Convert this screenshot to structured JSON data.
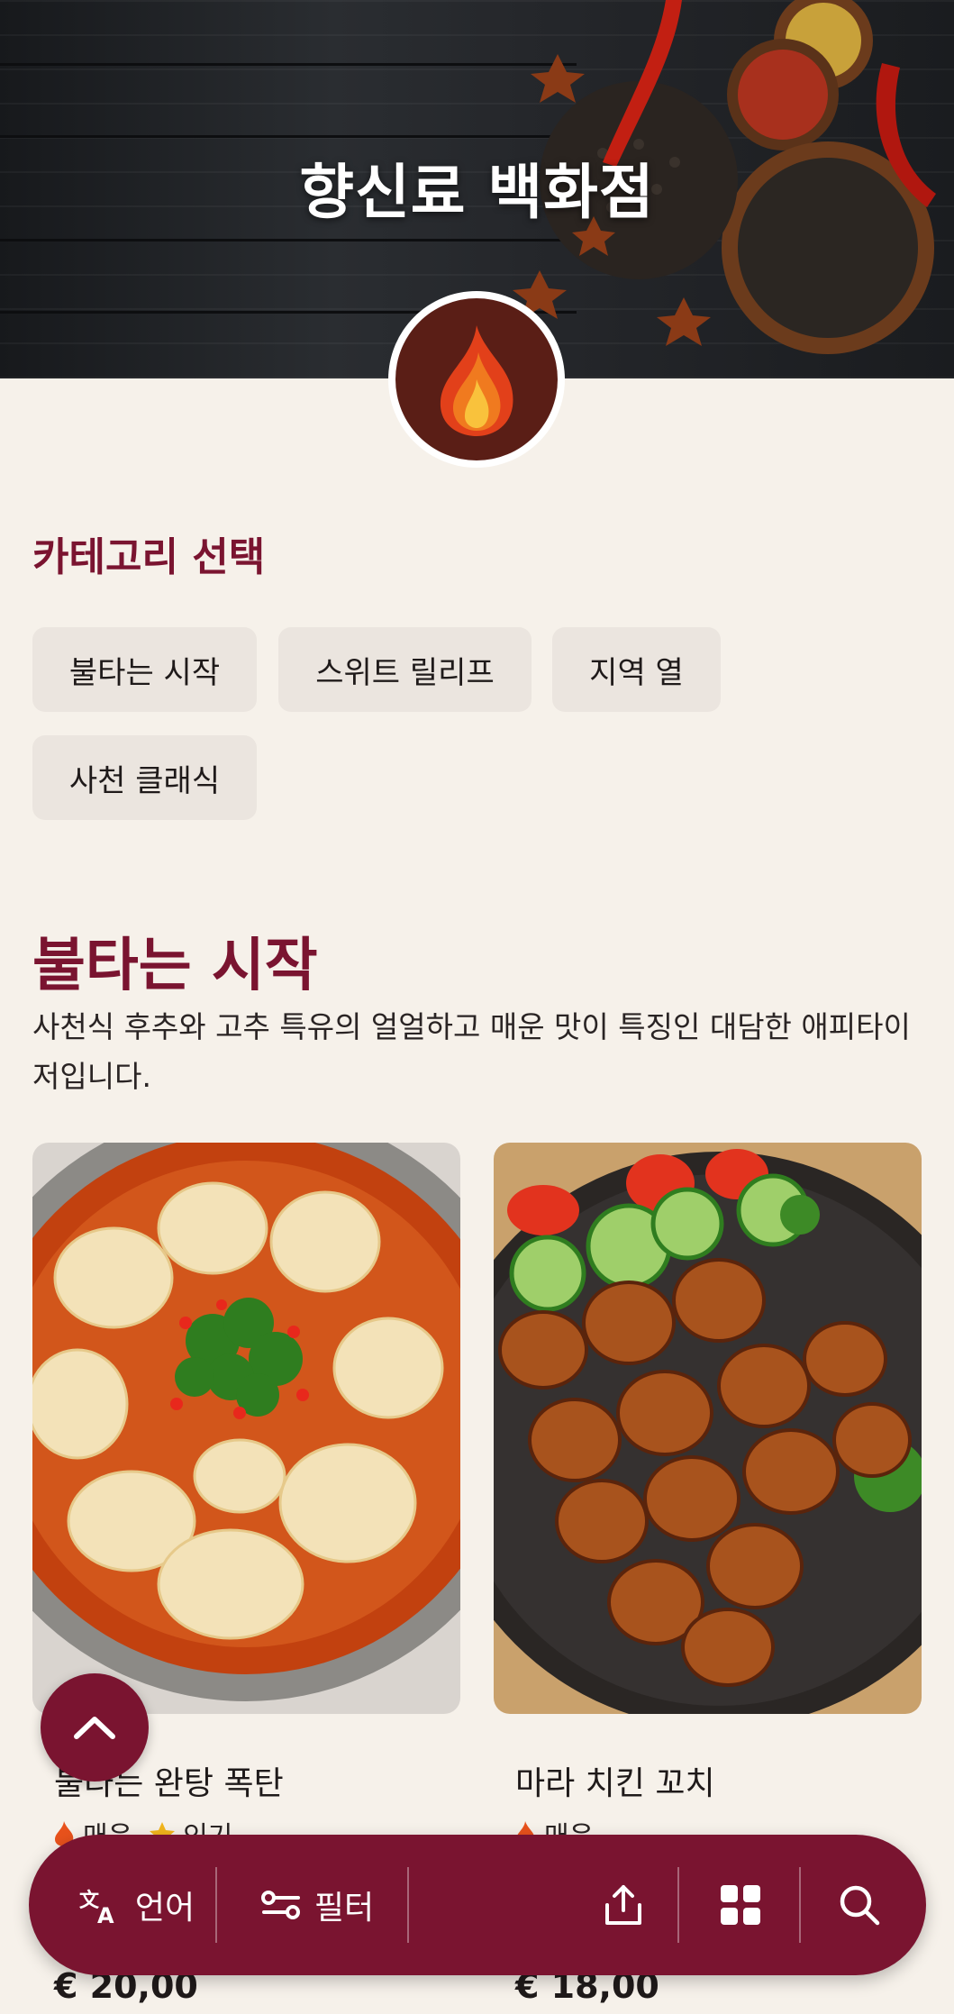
{
  "hero": {
    "title": "향신료 백화점"
  },
  "categories": {
    "heading": "카테고리 선택",
    "items": [
      {
        "label": "불타는 시작"
      },
      {
        "label": "스위트 릴리프"
      },
      {
        "label": "지역 열"
      },
      {
        "label": "사천 클래식"
      }
    ]
  },
  "section": {
    "title": "불타는 시작",
    "description": "사천식 후추와 고추 특유의 얼얼하고 매운 맛이 특징인 대담한 애피타이저입니다."
  },
  "products": [
    {
      "name": "불타는 완탕 폭탄",
      "tag_spicy": "매운",
      "tag_popular": "인기",
      "price": "€ 20,00"
    },
    {
      "name": "마라 치킨 꼬치",
      "tag_spicy": "매운",
      "price": "€ 18,00"
    }
  ],
  "bottom_bar": {
    "language_label": "언어",
    "filter_label": "필터"
  },
  "colors": {
    "accent": "#7a1430",
    "background": "#f6f1ea",
    "chip": "#ebe5df"
  },
  "icons": [
    "flame-logo-icon",
    "chevron-up-icon",
    "translate-icon",
    "filter-icon",
    "share-icon",
    "grid-icon",
    "search-icon",
    "fire-icon",
    "star-icon"
  ]
}
